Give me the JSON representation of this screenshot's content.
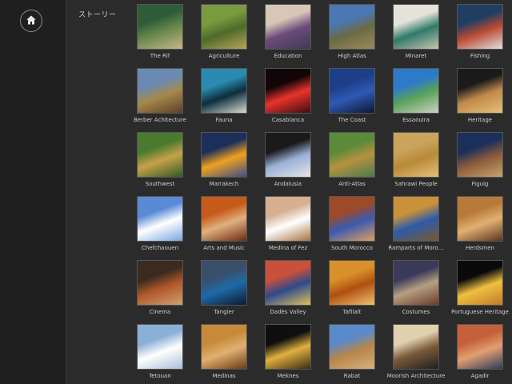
{
  "sidebar": {
    "label": "ストーリー",
    "home_icon": "home-icon"
  },
  "stories": [
    {
      "label": "The Rif",
      "colors": [
        "#2f5d3a",
        "#6a8a4c",
        "#c7b48a"
      ]
    },
    {
      "label": "Agriculture",
      "colors": [
        "#7a9a40",
        "#4e6a2a",
        "#b8a55a"
      ]
    },
    {
      "label": "Education",
      "colors": [
        "#d7c7b6",
        "#6b4a7a",
        "#3f3a55"
      ]
    },
    {
      "label": "High Atlas",
      "colors": [
        "#4a78b5",
        "#6a6a45",
        "#9c8a5a"
      ]
    },
    {
      "label": "Minaret",
      "colors": [
        "#e5e2da",
        "#2f7a6a",
        "#c9c3b0"
      ]
    },
    {
      "label": "Fishing",
      "colors": [
        "#1f3e62",
        "#b94a32",
        "#e0e0e0"
      ]
    },
    {
      "label": "Berber Achitecture",
      "colors": [
        "#6a8ab3",
        "#a5894a",
        "#5a3f2b"
      ]
    },
    {
      "label": "Fauna",
      "colors": [
        "#2a8ab0",
        "#0d2d3b",
        "#d8dcd2"
      ]
    },
    {
      "label": "Casablanca",
      "colors": [
        "#120507",
        "#e8332c",
        "#3b0d10"
      ]
    },
    {
      "label": "The Coast",
      "colors": [
        "#1d3f8a",
        "#2f5ab5",
        "#0c1630"
      ]
    },
    {
      "label": "Essaouira",
      "colors": [
        "#2d7ac9",
        "#5aa25a",
        "#d0d0c0"
      ]
    },
    {
      "label": "Heritage",
      "colors": [
        "#1a1a1a",
        "#c08a4a",
        "#e7c07a"
      ]
    },
    {
      "label": "Southwest",
      "colors": [
        "#4a7a30",
        "#c7a14a",
        "#2f5a23"
      ]
    },
    {
      "label": "Marrakech",
      "colors": [
        "#1b2f5a",
        "#f0a020",
        "#3a4d8a"
      ]
    },
    {
      "label": "Andalusia",
      "colors": [
        "#1a1a1a",
        "#9ab0d6",
        "#e6e6e6"
      ]
    },
    {
      "label": "Anti-Atlas",
      "colors": [
        "#5a8a3a",
        "#b5913f",
        "#4a7a50"
      ]
    },
    {
      "label": "Sahrawi People",
      "colors": [
        "#caa45a",
        "#b88a3a",
        "#e4c07a"
      ]
    },
    {
      "label": "Figuig",
      "colors": [
        "#1a2f5a",
        "#8a5a3a",
        "#c9a66a"
      ]
    },
    {
      "label": "Chefchaouen",
      "colors": [
        "#5a8ad6",
        "#ffffff",
        "#7aa6e0"
      ]
    },
    {
      "label": "Arts and Music",
      "colors": [
        "#c65a1a",
        "#e0b080",
        "#6a2a10"
      ]
    },
    {
      "label": "Medina of Fez",
      "colors": [
        "#d6b090",
        "#ffffff",
        "#a5723f"
      ]
    },
    {
      "label": "South Morocco",
      "colors": [
        "#9c4a28",
        "#3a5ab0",
        "#e0a060"
      ]
    },
    {
      "label": "Ramparts of Moro…",
      "colors": [
        "#c9923a",
        "#2e5aa9",
        "#7a5a2a"
      ]
    },
    {
      "label": "Herdsmen",
      "colors": [
        "#b87a3a",
        "#e0b070",
        "#5a3520"
      ]
    },
    {
      "label": "Cinema",
      "colors": [
        "#3a2a20",
        "#b0582a",
        "#d0a070"
      ]
    },
    {
      "label": "Tangier",
      "colors": [
        "#3a4f6a",
        "#1d6aa8",
        "#0d1a2a"
      ]
    },
    {
      "label": "Dadès Valley",
      "colors": [
        "#c9503a",
        "#2d4a8a",
        "#e0c060"
      ]
    },
    {
      "label": "Tafilalt",
      "colors": [
        "#d8902a",
        "#b04f10",
        "#f0c070"
      ]
    },
    {
      "label": "Costumes",
      "colors": [
        "#3a3a5a",
        "#b5a080",
        "#6a3a2a"
      ]
    },
    {
      "label": "Portuguese Heritage",
      "colors": [
        "#0a0a0a",
        "#f0c040",
        "#c07a2a"
      ]
    },
    {
      "label": "Tetouan",
      "colors": [
        "#8ab0d8",
        "#ffffff",
        "#a9bfd9"
      ]
    },
    {
      "label": "Medinas",
      "colors": [
        "#c68a3a",
        "#e0b070",
        "#6a3a15"
      ]
    },
    {
      "label": "Meknes",
      "colors": [
        "#0f0f0f",
        "#e0b040",
        "#3a2a10"
      ]
    },
    {
      "label": "Rabat",
      "colors": [
        "#5a8ac9",
        "#b8864a",
        "#d6b080"
      ]
    },
    {
      "label": "Moorish Architecture",
      "colors": [
        "#e0d0b0",
        "#7a5a3a",
        "#1f1f1f"
      ]
    },
    {
      "label": "Agadir",
      "colors": [
        "#c5603a",
        "#e0a070",
        "#2d3a5a"
      ]
    }
  ]
}
